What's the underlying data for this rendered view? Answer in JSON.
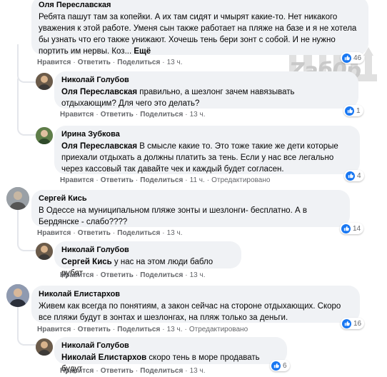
{
  "watermark": {
    "text": "Zаб0р"
  },
  "action_labels": {
    "like": "Нравится",
    "reply": "Ответить",
    "share": "Поделиться",
    "edited": "Отредактировано"
  },
  "comments": [
    {
      "author": "Оля Переславская",
      "text": "Ребята пашут там за копейки. А их там сидят и чмырят какие-то. Нет никакого уважения к этой работе. Уменя сын также работает на пляже на базе и я не хотела бы узнать что его также унижают. Хочешь тень бери зонт с собой. И не нужно портить им нервы. Коз...",
      "more": "Ещё",
      "time": "13 ч.",
      "reactions": "46"
    },
    {
      "author": "Николай Голубов",
      "mention": "Оля Переславская",
      "text": " правильно, а шезлонг зачем навязывать отдыхающим? Для чего это делать?",
      "time": "13 ч.",
      "reactions": "1"
    },
    {
      "author": "Ирина Зубкова",
      "mention": "Оля Переславская",
      "text": " В смысле какие то. Это тоже такие же дети которые приехали отдыхать а должны платить за тень. Если у нас все легально через кассовый так давайте чек и каждый будет согласен.",
      "time": "11 ч.",
      "edited": true,
      "reactions": "4"
    },
    {
      "author": "Сергей Кись",
      "text": "В Одессе на муниципальном пляже зонты и шезлонги- бесплатно. А в Бердянске - слабо????",
      "time": "13 ч.",
      "reactions": "14"
    },
    {
      "author": "Николай Голубов",
      "mention": "Сергей Кись",
      "text": " у нас на этом люди бабло рубят",
      "time": "13 ч."
    },
    {
      "author": "Николай Елистархов",
      "text": "Живем как всегда по понятиям, а закон сейчас на стороне отдыхающих. Скоро все пляжи будут в зонтах и шезлонгах, на пляж только за деньги.",
      "time": "13 ч.",
      "edited": true,
      "reactions": "16"
    },
    {
      "author": "Николай Голубов",
      "mention": "Николай Елистархов",
      "text": " скоро тень в море продавать будут",
      "time": "13 ч.",
      "reactions": "6"
    }
  ]
}
